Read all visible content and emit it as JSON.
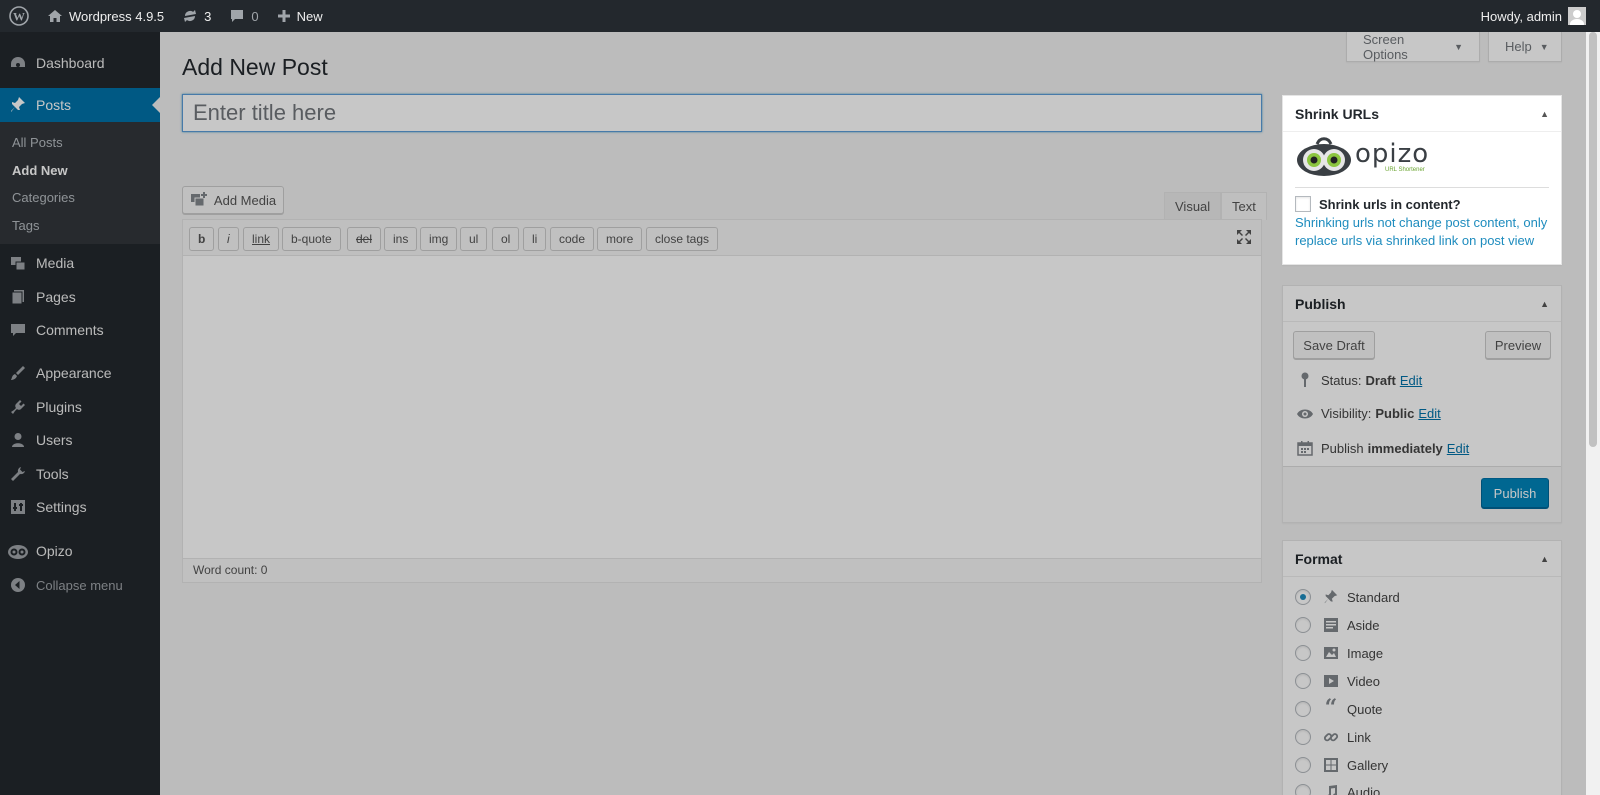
{
  "adminbar": {
    "site_name": "Wordpress 4.9.5",
    "updates_count": "3",
    "comments_count": "0",
    "new_label": "New",
    "howdy": "Howdy, admin"
  },
  "sidebar": {
    "dashboard": "Dashboard",
    "posts": "Posts",
    "submenu": [
      "All Posts",
      "Add New",
      "Categories",
      "Tags"
    ],
    "media": "Media",
    "pages": "Pages",
    "comments": "Comments",
    "appearance": "Appearance",
    "plugins": "Plugins",
    "users": "Users",
    "tools": "Tools",
    "settings": "Settings",
    "opizo": "Opizo",
    "collapse": "Collapse menu"
  },
  "screen_meta": {
    "screen_options": "Screen Options",
    "help": "Help"
  },
  "page": {
    "title": "Add New Post",
    "title_placeholder": "Enter title here",
    "add_media": "Add Media"
  },
  "editor": {
    "tabs": [
      "Visual",
      "Text"
    ],
    "active_tab": "Text",
    "quicktags": [
      "b",
      "i",
      "link",
      "b-quote",
      "del",
      "ins",
      "img",
      "ul",
      "ol",
      "li",
      "code",
      "more",
      "close tags"
    ],
    "word_count": "Word count: 0"
  },
  "shrink_box": {
    "title": "Shrink URLs",
    "logo_text": "opizo",
    "logo_tagline": "URL Shortener",
    "checkbox_label": "Shrink urls in content?",
    "checkbox_checked": false,
    "description": "Shrinking urls not change post content, only replace urls via shrinked link on post view"
  },
  "publish_box": {
    "title": "Publish",
    "save_draft": "Save Draft",
    "preview": "Preview",
    "status_label": "Status:",
    "status_value": "Draft",
    "visibility_label": "Visibility:",
    "visibility_value": "Public",
    "publish_label": "Publish",
    "publish_value": "immediately",
    "edit": "Edit",
    "publish_button": "Publish"
  },
  "format_box": {
    "title": "Format",
    "options": [
      "Standard",
      "Aside",
      "Image",
      "Video",
      "Quote",
      "Link",
      "Gallery",
      "Audio"
    ],
    "selected": "Standard"
  },
  "colors": {
    "admin_dark": "#23282d",
    "accent_blue": "#0073aa",
    "link_blue": "#1e8cbe",
    "button_primary": "#0085ba"
  }
}
